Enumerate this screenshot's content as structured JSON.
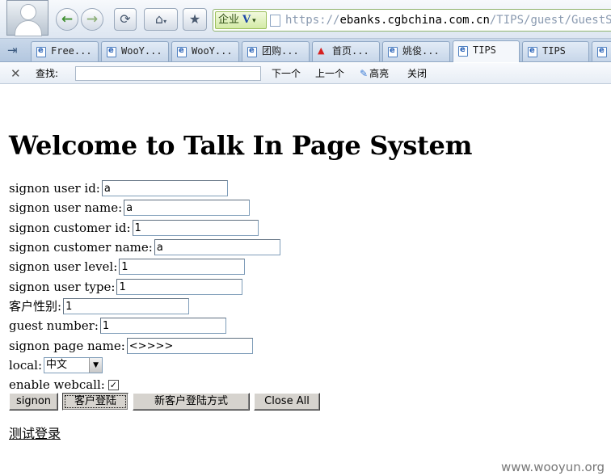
{
  "browser": {
    "enterprise_badge": "企业",
    "enterprise_logo": "V",
    "url_prefix": "https://",
    "url_domain": "ebanks.cgbchina.com.cn",
    "url_path": "/TIPS/guest/GuestSi",
    "tabs": [
      {
        "label": "Free..."
      },
      {
        "label": "WooY..."
      },
      {
        "label": "WooY..."
      },
      {
        "label": "团购..."
      },
      {
        "label": "首页..."
      },
      {
        "label": "姚俊..."
      },
      {
        "label": "TIPS"
      },
      {
        "label": "TIPS"
      }
    ],
    "find_bar": {
      "label": "查找:",
      "next": "下一个",
      "prev": "上一个",
      "highlight": "高亮",
      "close": "关闭"
    }
  },
  "page": {
    "title": "Welcome to Talk In Page System",
    "fields": [
      {
        "label": "signon user id:",
        "value": "a"
      },
      {
        "label": "signon user name:",
        "value": "a"
      },
      {
        "label": "signon customer id:",
        "value": "1"
      },
      {
        "label": "signon customer name:",
        "value": "a"
      },
      {
        "label": "signon user level:",
        "value": "1"
      },
      {
        "label": "signon user type:",
        "value": "1"
      },
      {
        "label": "客户性别:",
        "value": "1"
      },
      {
        "label": "guest number:",
        "value": "1"
      },
      {
        "label": "signon page name:",
        "value": "<>>>>"
      }
    ],
    "local": {
      "label": "local:",
      "selected": "中文"
    },
    "webcall": {
      "label": "enable webcall:",
      "checked": true,
      "check_glyph": "✓"
    },
    "buttons": {
      "signon": "signon",
      "customer_login": "客户登陆",
      "new_customer_login": "新客户登陆方式",
      "close_all": "Close All"
    },
    "test_login_link": "测试登录"
  },
  "watermark": "www.wooyun.org"
}
